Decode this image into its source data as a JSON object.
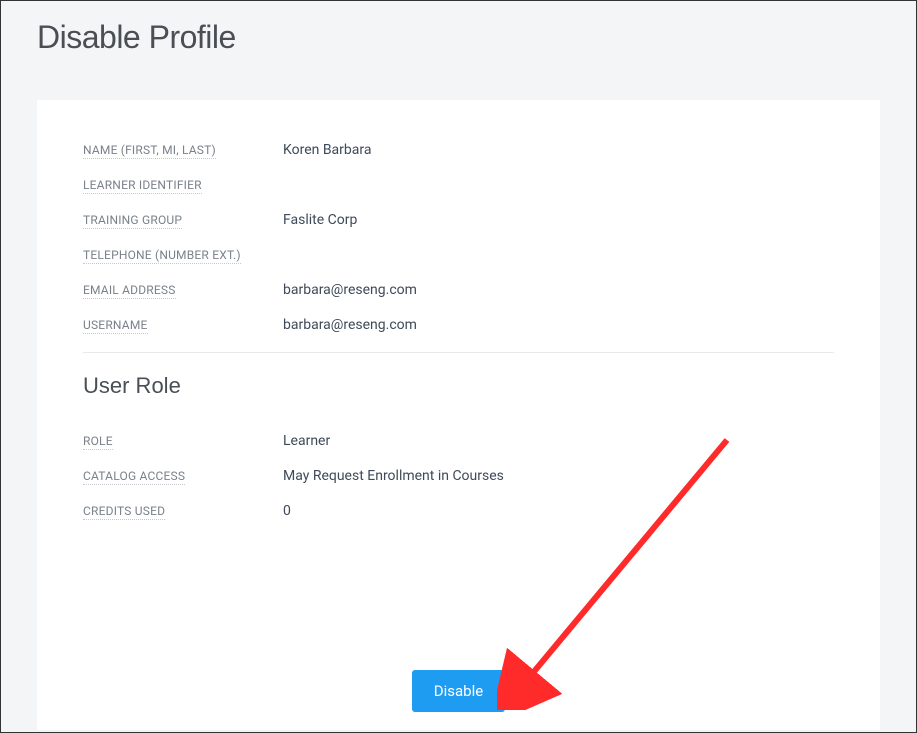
{
  "header": {
    "page_title": "Disable Profile"
  },
  "profile": {
    "fields": [
      {
        "label": "NAME (FIRST, MI, LAST)",
        "value": "Koren Barbara"
      },
      {
        "label": "LEARNER IDENTIFIER",
        "value": ""
      },
      {
        "label": "TRAINING GROUP",
        "value": "Faslite Corp"
      },
      {
        "label": "TELEPHONE (NUMBER EXT.)",
        "value": ""
      },
      {
        "label": "EMAIL ADDRESS",
        "value": "barbara@reseng.com"
      },
      {
        "label": "USERNAME",
        "value": "barbara@reseng.com"
      }
    ]
  },
  "role_section": {
    "title": "User Role",
    "fields": [
      {
        "label": "ROLE",
        "value": "Learner"
      },
      {
        "label": "CATALOG ACCESS",
        "value": "May Request Enrollment in Courses"
      },
      {
        "label": "CREDITS USED",
        "value": "0"
      }
    ]
  },
  "actions": {
    "disable_label": "Disable"
  },
  "colors": {
    "primary_button": "#1e9cf2",
    "annotation_arrow": "#ff2a2a"
  }
}
